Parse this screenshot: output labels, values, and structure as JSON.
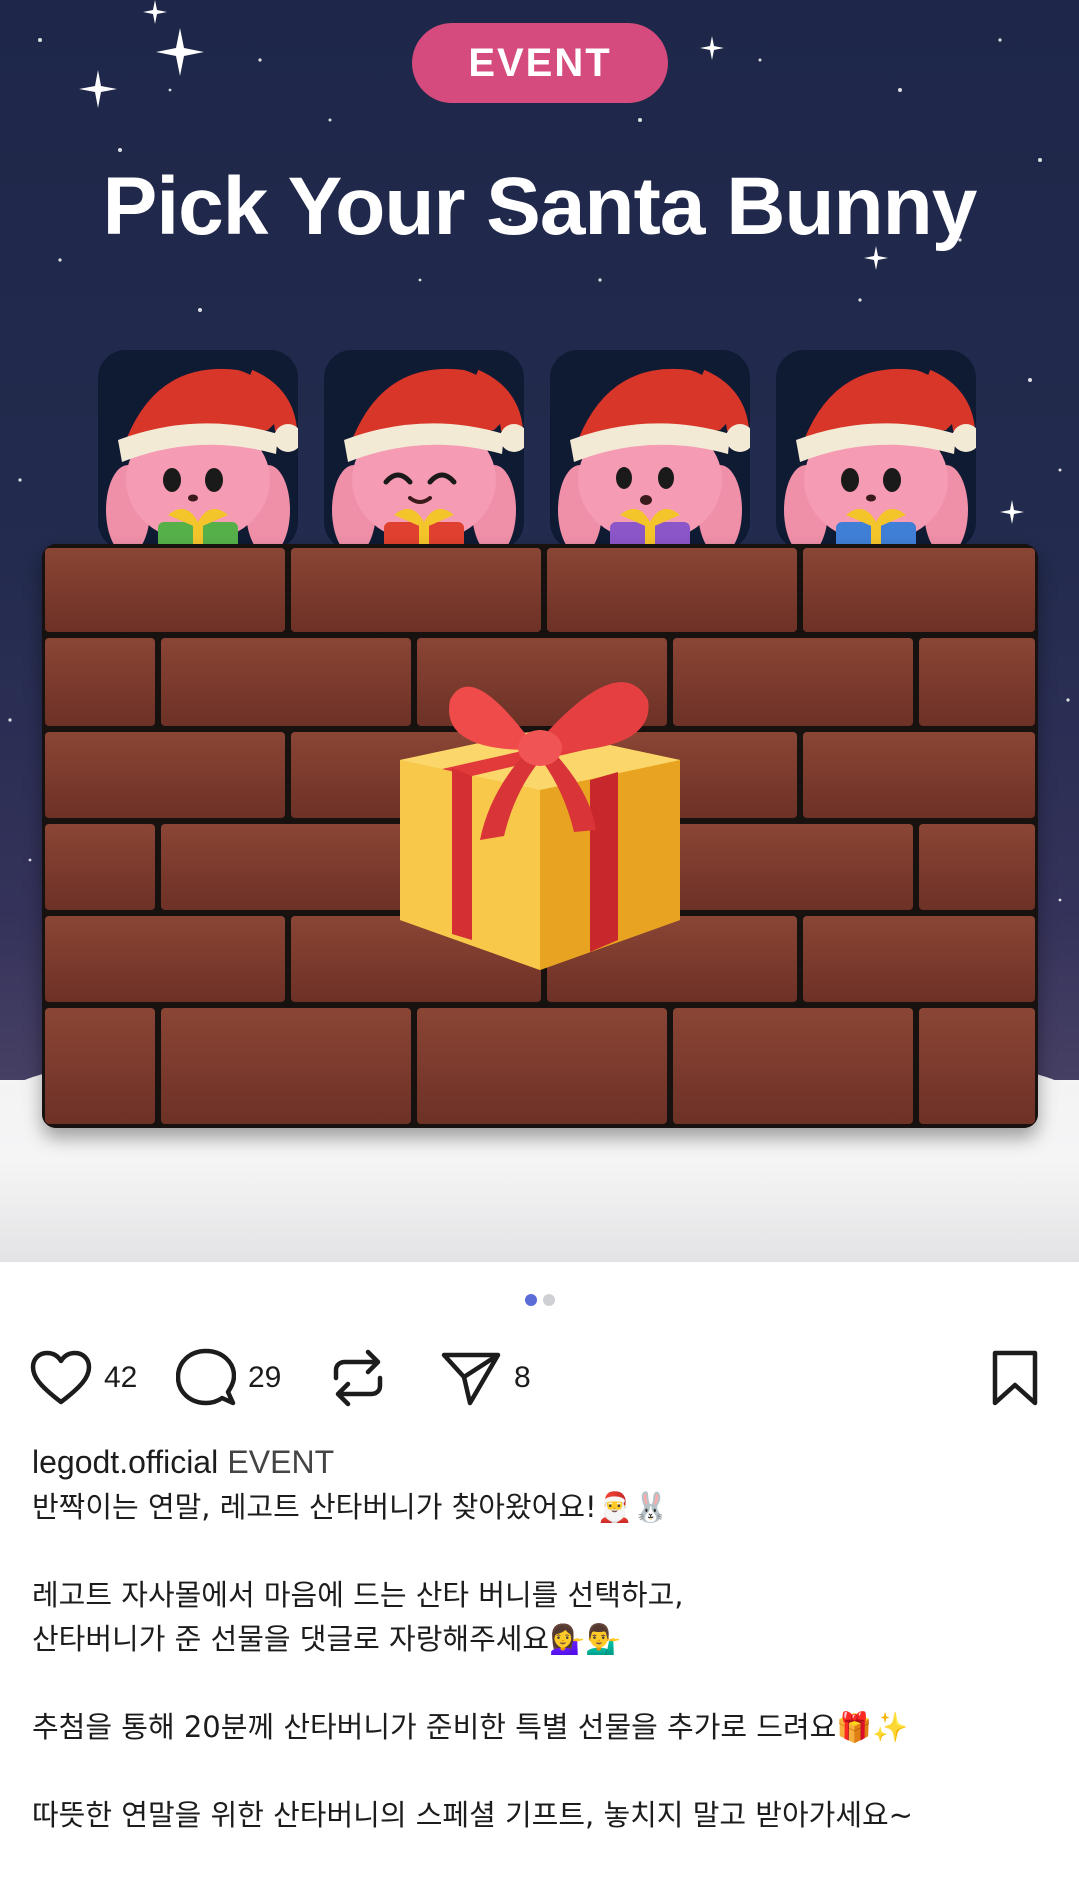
{
  "post": {
    "badge": "EVENT",
    "title": "Pick Your Santa Bunny",
    "bunnies": [
      {
        "face": "dot-eyes",
        "gift_color": "#55b04a"
      },
      {
        "face": "smiling-eyes",
        "gift_color": "#e0402f"
      },
      {
        "face": "open-mouth",
        "gift_color": "#8b56c8"
      },
      {
        "face": "dot-eyes",
        "gift_color": "#3f7fd6"
      }
    ]
  },
  "carousel": {
    "count": 2,
    "active": 0
  },
  "actions": {
    "likes": "42",
    "comments": "29",
    "shares": "8"
  },
  "caption": {
    "username": "legodt.official",
    "tag": "EVENT",
    "lines": [
      "반짝이는 연말, 레고트 산타버니가 찾아왔어요!🎅🐰",
      "",
      "레고트 자사몰에서 마음에 드는 산타 버니를 선택하고,",
      "산타버니가 준 선물을 댓글로 자랑해주세요💁‍♀️💁‍♂️",
      "",
      "추첨을 통해 20분께 산타버니가 준비한 특별 선물을 추가로 드려요🎁✨",
      "",
      "따뜻한 연말을 위한 산타버니의 스페셜 기프트, 놓치지 말고 받아가세요~"
    ]
  },
  "colors": {
    "sky": "#1e2749",
    "badge": "#d64b7d",
    "brick": "#7a3a2c",
    "accent_dot": "#5b6bd8"
  }
}
